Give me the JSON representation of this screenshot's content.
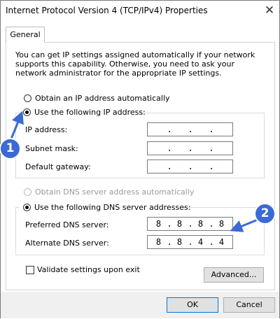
{
  "window": {
    "title": "Internet Protocol Version 4 (TCP/IPv4) Properties",
    "close_glyph": "✕"
  },
  "tabs": [
    {
      "label": "General"
    }
  ],
  "description": "You can get IP settings assigned automatically if your network supports this capability. Otherwise, you need to ask your network administrator for the appropriate IP settings.",
  "ip": {
    "auto_label": "Obtain an IP address automatically",
    "manual_label": "Use the following IP address:",
    "selected": "manual",
    "fields": [
      {
        "label": "IP address:",
        "value": [
          ".",
          ".",
          "."
        ]
      },
      {
        "label": "Subnet mask:",
        "value": [
          ".",
          ".",
          "."
        ]
      },
      {
        "label": "Default gateway:",
        "value": [
          ".",
          ".",
          "."
        ]
      }
    ]
  },
  "dns": {
    "auto_label": "Obtain DNS server address automatically",
    "manual_label": "Use the following DNS server addresses:",
    "selected": "manual",
    "preferred": {
      "label": "Preferred DNS server:",
      "octets": [
        "8",
        "8",
        "8",
        "8"
      ]
    },
    "alternate": {
      "label": "Alternate DNS server:",
      "octets": [
        "8",
        "8",
        "4",
        "4"
      ]
    }
  },
  "validate": {
    "label": "Validate settings upon exit",
    "checked": false
  },
  "buttons": {
    "advanced": "Advanced...",
    "ok": "OK",
    "cancel": "Cancel"
  },
  "annotations": {
    "badge1": "1",
    "badge2": "2"
  },
  "colors": {
    "badge": "#3b69d6",
    "accent": "#0078d7"
  }
}
